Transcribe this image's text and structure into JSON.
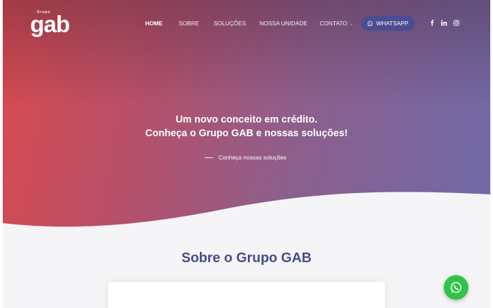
{
  "logo": {
    "small": "Grupo",
    "big": "gab"
  },
  "nav": {
    "items": [
      {
        "label": "HOME"
      },
      {
        "label": "SOBRE"
      },
      {
        "label": "SOLUÇÕES"
      },
      {
        "label": "NOSSA UNIDADE"
      },
      {
        "label": "CONTATO"
      }
    ],
    "whatsapp_label": "WHATSAPP",
    "social_icons": [
      "facebook-icon",
      "linkedin-icon",
      "instagram-icon"
    ]
  },
  "hero": {
    "headline_line1": "Um novo conceito em crédito.",
    "headline_line2": "Conheça o Grupo GAB e nossas soluções!",
    "cta_label": "Conheça nossas soluções"
  },
  "about": {
    "title": "Sobre o Grupo GAB"
  },
  "colors": {
    "gradient_start": "#d94a4e",
    "gradient_end": "#6f6aa8",
    "nav_button": "#4b4d92",
    "section_title": "#4a4a8c",
    "whatsapp_fab": "#2fc34a"
  }
}
